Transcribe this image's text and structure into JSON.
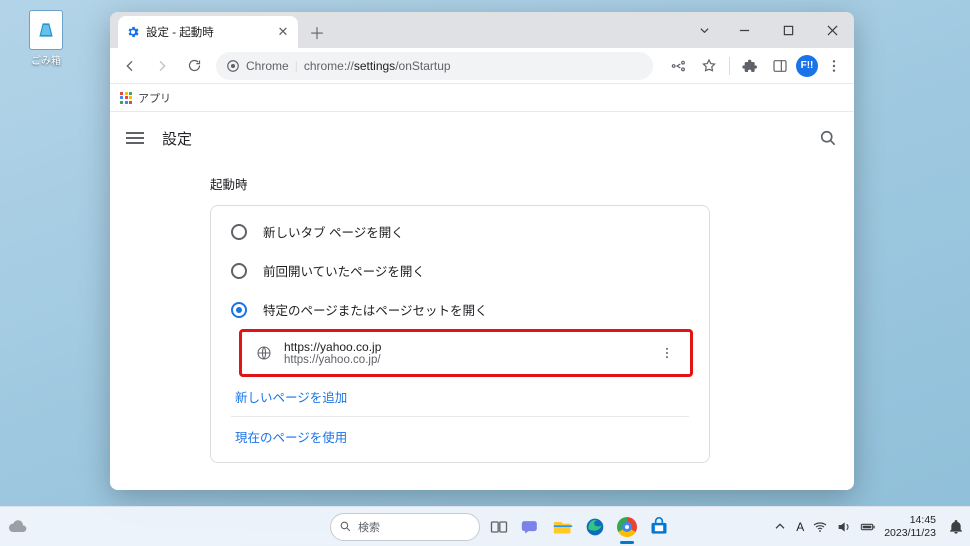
{
  "desktop": {
    "recycle_bin": "ごみ箱"
  },
  "window": {
    "tab_title": "設定 - 起動時",
    "address_prefix": "Chrome",
    "address_path_plain": "chrome://",
    "address_path_bold": "settings",
    "address_path_rest": "/onStartup",
    "avatar": "F!!"
  },
  "bookmarks": {
    "apps": "アプリ"
  },
  "settings": {
    "header": "設定",
    "section": "起動時",
    "opt_new_tab": "新しいタブ ページを開く",
    "opt_continue": "前回開いていたページを開く",
    "opt_specific": "特定のページまたはページセットを開く",
    "page_title": "https://yahoo.co.jp",
    "page_url": "https://yahoo.co.jp/",
    "add_page": "新しいページを追加",
    "use_current": "現在のページを使用"
  },
  "taskbar": {
    "search_placeholder": "検索",
    "ime": "A",
    "time": "14:45",
    "date": "2023/11/23"
  }
}
